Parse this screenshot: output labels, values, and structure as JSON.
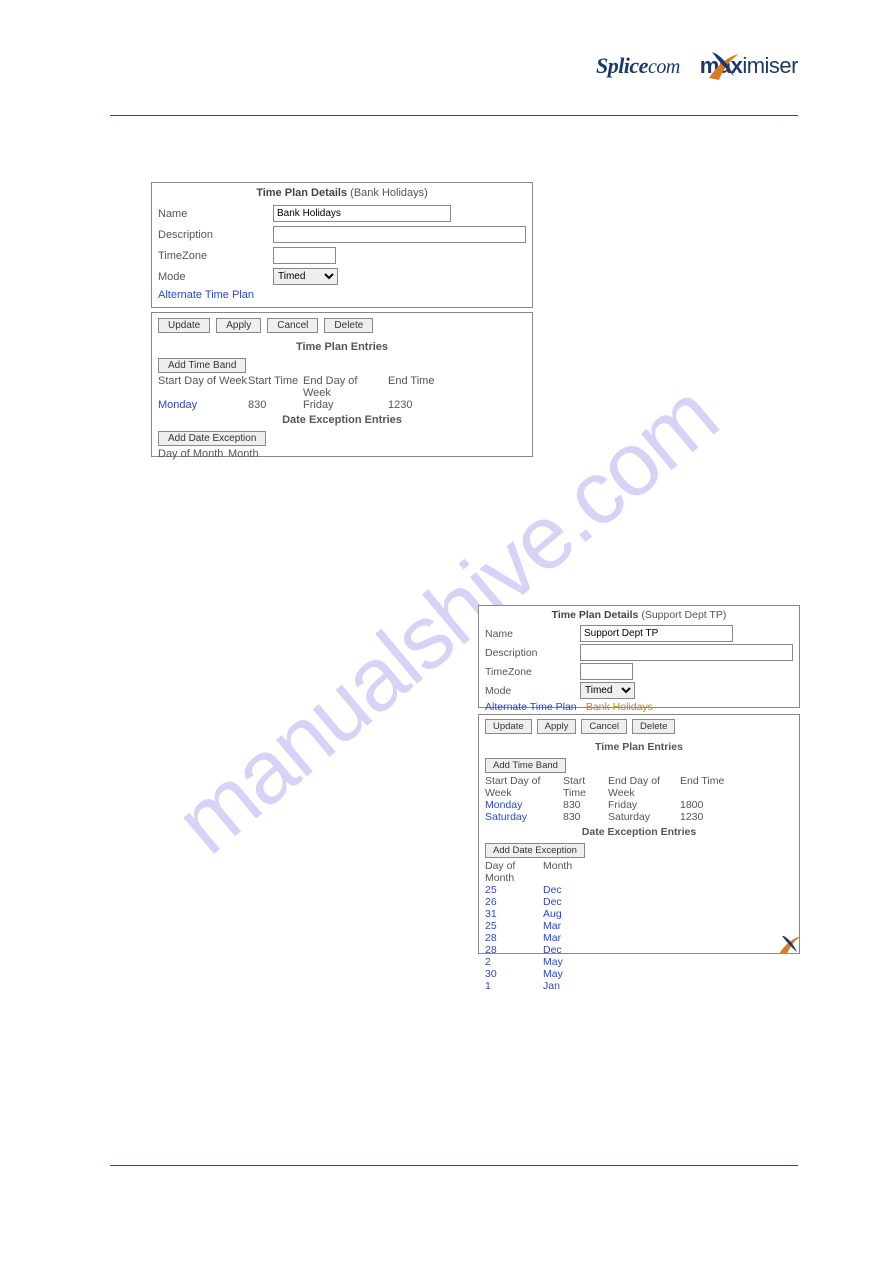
{
  "watermark": "manualshive.com",
  "logo": {
    "t1": "Splice",
    "t2": "com",
    "t3": "max",
    "t4": "imiser"
  },
  "panel1": {
    "title_bold": "Time Plan Details",
    "title_paren": "(Bank Holidays)",
    "labels": {
      "name": "Name",
      "desc": "Description",
      "tz": "TimeZone",
      "mode": "Mode",
      "alt": "Alternate Time Plan"
    },
    "values": {
      "name": "Bank Holidays",
      "desc": "",
      "tz": "",
      "mode": "Timed"
    },
    "buttons": {
      "update": "Update",
      "apply": "Apply",
      "cancel": "Cancel",
      "delete": "Delete"
    },
    "entries_title": "Time Plan Entries",
    "add_timeband": "Add Time Band",
    "timeband_headers": [
      "Start Day of Week",
      "Start Time",
      "End Day of Week",
      "End Time"
    ],
    "timebands": [
      {
        "sd": "Monday",
        "st": "830",
        "ed": "Friday",
        "et": "1230"
      }
    ],
    "dateex_title": "Date Exception Entries",
    "add_dateex": "Add Date Exception",
    "dateex_headers": [
      "Day of Month",
      "Month"
    ],
    "dateex": []
  },
  "panel2": {
    "title_bold": "Time Plan Details",
    "title_paren": "(Support Dept TP)",
    "labels": {
      "name": "Name",
      "desc": "Description",
      "tz": "TimeZone",
      "mode": "Mode",
      "alt": "Alternate Time Plan"
    },
    "values": {
      "name": "Support Dept TP",
      "desc": "",
      "tz": "",
      "mode": "Timed",
      "alt": "Bank Holidays"
    },
    "buttons": {
      "update": "Update",
      "apply": "Apply",
      "cancel": "Cancel",
      "delete": "Delete"
    },
    "entries_title": "Time Plan Entries",
    "add_timeband": "Add Time Band",
    "timeband_headers": [
      "Start Day of Week",
      "Start Time",
      "End Day of Week",
      "End Time"
    ],
    "timebands": [
      {
        "sd": "Monday",
        "st": "830",
        "ed": "Friday",
        "et": "1800"
      },
      {
        "sd": "Saturday",
        "st": "830",
        "ed": "Saturday",
        "et": "1230"
      }
    ],
    "dateex_title": "Date Exception Entries",
    "add_dateex": "Add Date Exception",
    "dateex_headers": [
      "Day of Month",
      "Month"
    ],
    "dateex": [
      {
        "d": "25",
        "m": "Dec"
      },
      {
        "d": "26",
        "m": "Dec"
      },
      {
        "d": "31",
        "m": "Aug"
      },
      {
        "d": "25",
        "m": "Mar"
      },
      {
        "d": "28",
        "m": "Mar"
      },
      {
        "d": "28",
        "m": "Dec"
      },
      {
        "d": "2",
        "m": "May"
      },
      {
        "d": "30",
        "m": "May"
      },
      {
        "d": "1",
        "m": "Jan"
      }
    ]
  }
}
